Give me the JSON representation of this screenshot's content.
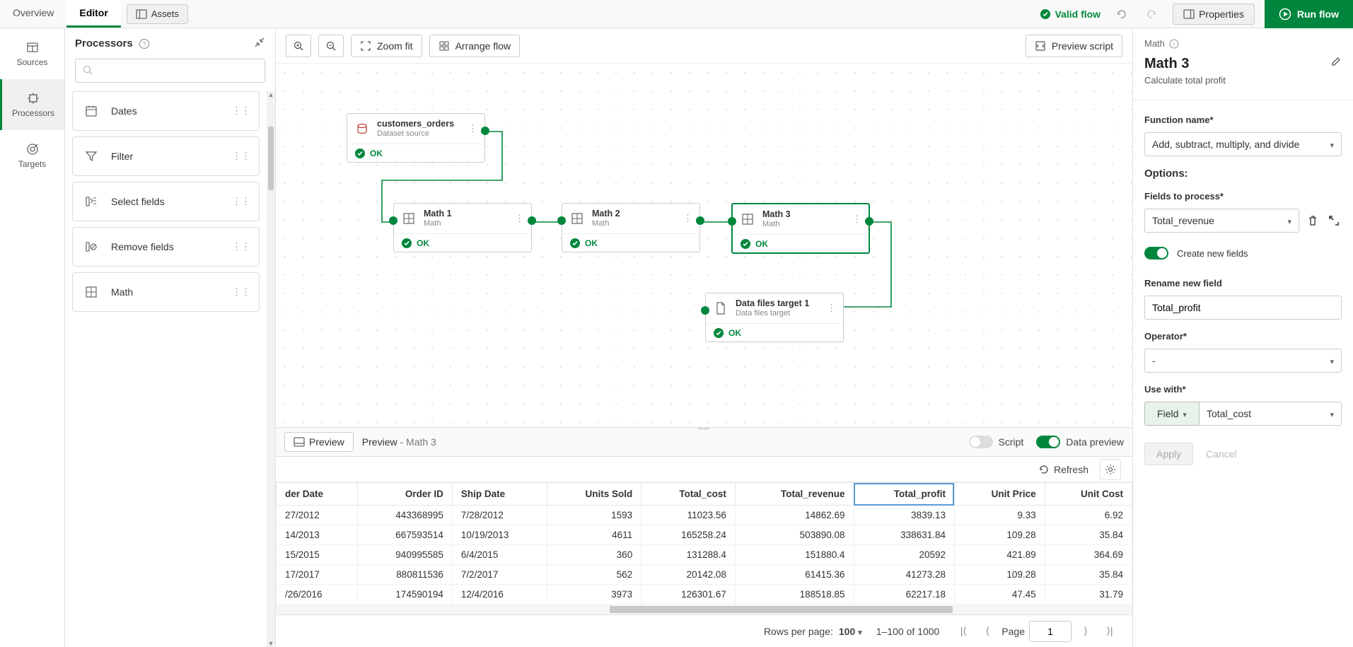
{
  "topbar": {
    "tab_overview": "Overview",
    "tab_editor": "Editor",
    "assets": "Assets",
    "valid_flow": "Valid flow",
    "properties": "Properties",
    "run_flow": "Run flow"
  },
  "leftstrip": {
    "sources": "Sources",
    "processors": "Processors",
    "targets": "Targets"
  },
  "procpanel": {
    "title": "Processors",
    "search_placeholder": "",
    "items": [
      {
        "label": "Dates"
      },
      {
        "label": "Filter"
      },
      {
        "label": "Select fields"
      },
      {
        "label": "Remove fields"
      },
      {
        "label": "Math"
      }
    ]
  },
  "canvasbar": {
    "zoom_fit": "Zoom fit",
    "arrange_flow": "Arrange flow",
    "preview_script": "Preview script"
  },
  "nodes": {
    "src": {
      "title": "customers_orders",
      "sub": "Dataset source",
      "status": "OK"
    },
    "m1": {
      "title": "Math 1",
      "sub": "Math",
      "status": "OK"
    },
    "m2": {
      "title": "Math 2",
      "sub": "Math",
      "status": "OK"
    },
    "m3": {
      "title": "Math 3",
      "sub": "Math",
      "status": "OK"
    },
    "tgt": {
      "title": "Data files target 1",
      "sub": "Data files target",
      "status": "OK"
    }
  },
  "previewbar": {
    "preview_btn": "Preview",
    "crumb_main": "Preview",
    "crumb_sub": " - Math 3",
    "script": "Script",
    "data_preview": "Data preview"
  },
  "tableactions": {
    "refresh": "Refresh"
  },
  "table": {
    "headers": [
      "der Date",
      "Order ID",
      "Ship Date",
      "Units Sold",
      "Total_cost",
      "Total_revenue",
      "Total_profit",
      "Unit Price",
      "Unit Cost"
    ],
    "num_cols": [
      false,
      true,
      false,
      true,
      true,
      true,
      true,
      true,
      true
    ],
    "highlight_col": 6,
    "rows": [
      [
        "27/2012",
        "443368995",
        "7/28/2012",
        "1593",
        "11023.56",
        "14862.69",
        "3839.13",
        "9.33",
        "6.92"
      ],
      [
        "14/2013",
        "667593514",
        "10/19/2013",
        "4611",
        "165258.24",
        "503890.08",
        "338631.84",
        "109.28",
        "35.84"
      ],
      [
        "15/2015",
        "940995585",
        "6/4/2015",
        "360",
        "131288.4",
        "151880.4",
        "20592",
        "421.89",
        "364.69"
      ],
      [
        "17/2017",
        "880811536",
        "7/2/2017",
        "562",
        "20142.08",
        "61415.36",
        "41273.28",
        "109.28",
        "35.84"
      ],
      [
        "/26/2016",
        "174590194",
        "12/4/2016",
        "3973",
        "126301.67",
        "188518.85",
        "62217.18",
        "47.45",
        "31.79"
      ]
    ]
  },
  "pager": {
    "rpp_label": "Rows per page:",
    "rpp_value": "100",
    "range": "1–100 of 1000",
    "page_label": "Page",
    "page_value": "1"
  },
  "rightpanel": {
    "crumb": "Math",
    "title": "Math 3",
    "subtitle": "Calculate total profit",
    "fn_label": "Function name*",
    "fn_value": "Add, subtract, multiply, and divide",
    "options": "Options:",
    "fields_label": "Fields to process*",
    "fields_value": "Total_revenue",
    "create_new": "Create new fields",
    "rename_label": "Rename new field",
    "rename_value": "Total_profit",
    "operator_label": "Operator*",
    "operator_value": "-",
    "usewith_label": "Use with*",
    "usewith_mode": "Field",
    "usewith_value": "Total_cost",
    "apply": "Apply",
    "cancel": "Cancel"
  }
}
